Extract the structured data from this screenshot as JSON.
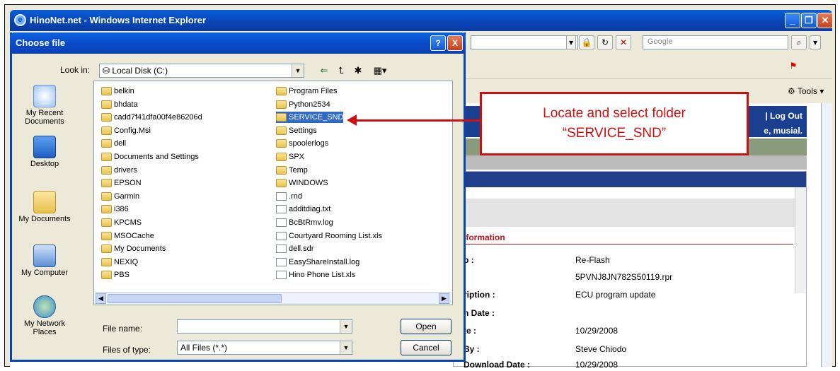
{
  "ie": {
    "title": "HinoNet.net - Windows Internet Explorer",
    "search_placeholder": "Google",
    "tools_label": "Tools",
    "logout": "| Log Out",
    "welcome": "e, musial."
  },
  "page": {
    "section_title": "nformation",
    "rows": [
      {
        "label": "p :",
        "value": "Re-Flash"
      },
      {
        "label": ":",
        "value": "5PVNJ8JN782S50119.rpr"
      },
      {
        "label": "ription :",
        "value": "ECU program update"
      },
      {
        "label": "h Date :",
        "value": ""
      },
      {
        "label": "te :",
        "value": "10/29/2008"
      },
      {
        "label": "By :",
        "value": "Steve Chiodo"
      },
      {
        "label": "Download Date :",
        "value": "10/29/2008"
      }
    ]
  },
  "dialog": {
    "title": "Choose file",
    "help": "?",
    "close": "X",
    "look_in_label": "Look in:",
    "look_in_value": "Local Disk (C:)",
    "places": [
      {
        "label": "My Recent Documents",
        "icon": "recent-documents-icon"
      },
      {
        "label": "Desktop",
        "icon": "desktop-icon"
      },
      {
        "label": "My Documents",
        "icon": "my-documents-icon"
      },
      {
        "label": "My Computer",
        "icon": "my-computer-icon"
      },
      {
        "label": "My Network Places",
        "icon": "network-places-icon"
      }
    ],
    "col1": [
      "belkin",
      "bhdata",
      "cadd7f41dfa00f4e86206d",
      "Config.Msi",
      "dell",
      "Documents and Settings",
      "drivers",
      "EPSON",
      "Garmin",
      "i386",
      "KPCMS",
      "MSOCache",
      "My Documents",
      "NEXIQ",
      "PBS"
    ],
    "col2": [
      "Program Files",
      "Python2534",
      "SERVICE_SND",
      "Settings",
      "spoolerlogs",
      "SPX",
      "Temp",
      "WINDOWS",
      ".rnd",
      "additdiag.txt",
      "BcBtRmv.log",
      "Courtyard Rooming List.xls",
      "dell.sdr",
      "EasyShareInstall.log",
      "Hino Phone List.xls"
    ],
    "selected": "SERVICE_SND",
    "file_name_label": "File name:",
    "file_name_value": "",
    "file_type_label": "Files of type:",
    "file_type_value": "All Files (*.*)",
    "open_label": "Open",
    "cancel_label": "Cancel"
  },
  "callout": {
    "line1": "Locate and select folder",
    "line2": "“SERVICE_SND”"
  }
}
